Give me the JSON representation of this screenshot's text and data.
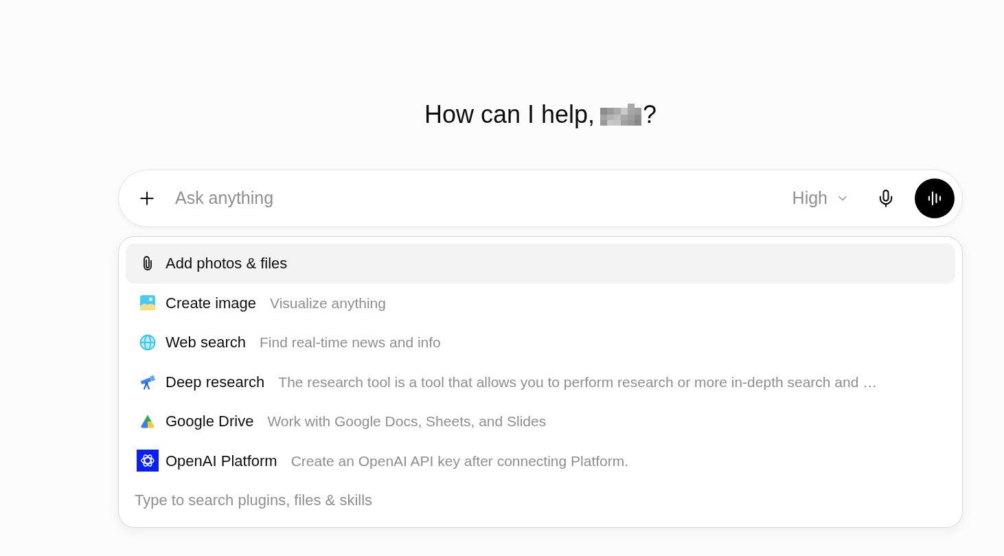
{
  "greeting": {
    "text_before": "How can I help,",
    "text_after": "?"
  },
  "composer": {
    "placeholder": "Ask anything",
    "effort": "High"
  },
  "menu": {
    "items": [
      {
        "label": "Add photos & files",
        "selected": true
      },
      {
        "label": "Create image",
        "description": "Visualize anything",
        "selected": false
      },
      {
        "label": "Web search",
        "description": "Find real-time news and info",
        "selected": false
      },
      {
        "label": "Deep research",
        "description": "The research tool is a tool that allows you to perform research or more in-depth search and …",
        "selected": false
      },
      {
        "label": "Google Drive",
        "description": "Work with Google Docs, Sheets, and Slides",
        "selected": false
      },
      {
        "label": "OpenAI Platform",
        "description": "Create an OpenAI API key after connecting Platform.",
        "selected": false
      }
    ],
    "search": {
      "placeholder": "Type to search plugins, files & skills"
    }
  }
}
